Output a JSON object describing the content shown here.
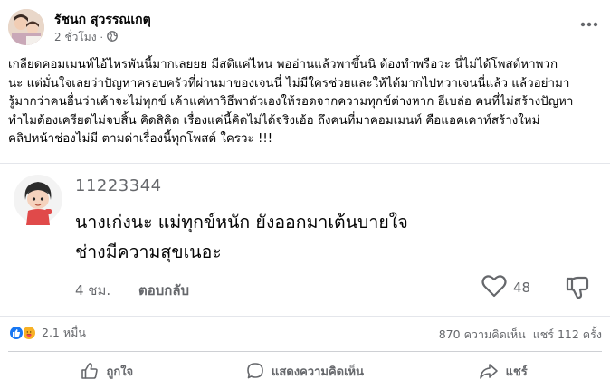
{
  "post": {
    "author": "รัชนก สุวรรณเกตุ",
    "time": "2 ชั่วโมง",
    "dot": "·",
    "audience_icon": "globe-icon",
    "more_icon": "more-horizontal-icon",
    "text_lines": [
      "เกลียดคอมเมนท์ไอ้ไหรพันนี้มากเลยยย มีสติแค่ไหน พออ่านแล้วพาขึ้นนิ ต้องทำพรือวะ นี่ไม่ได้โพสต์หาพวก",
      "นะ แต่มั่นใจเลยว่าปัญหาครอบครัวที่ผ่านมาของเจนนี่ ไม่มีใครช่วยและให้ได้มากไปหวาเจนนี่แล้ว แล้วอย่ามา",
      "รู้มากว่าคนอื่นว่าเค้าจะไม่ทุกข์ เค้าแค่หาวิธีพาตัวเองให้รอดจากความทุกข์ต่างหาก อีเบล่อ คนที่ไม่สร้างปัญหา",
      "ทำไมต้องเครียดไม่จบสิ้น คิดสิคิด เรื่องแค่นี้คิดไม่ได้จริงเอ้อ ถึงคนที่มาคอมเมนท์ คือแอคเคาท์สร้างใหม่",
      "คลิปหน้าช่องไม่มี ตามด่าเรื่องนี้ทุกโพสต์ ใครวะ !!!"
    ]
  },
  "comment": {
    "username": "11223344",
    "text_lines": [
      "นางเก่งนะ แม่ทุกข์หนัก ยังออกมาเต้นบายใจ",
      "ช่างมีความสุขเนอะ"
    ],
    "time": "4 ชม.",
    "reply_label": "ตอบกลับ",
    "like_count": "48",
    "like_icon": "heart-outline-icon",
    "dislike_icon": "thumbs-down-icon"
  },
  "stats": {
    "reaction_count": "2.1 หมื่น",
    "comments": "870 ความคิดเห็น",
    "shares": "แชร์ 112 ครั้ง"
  },
  "actions": {
    "like": "ถูกใจ",
    "comment": "แสดงความคิดเห็น",
    "share": "แชร์"
  },
  "colors": {
    "like_blue": "#1877f2",
    "care_yellow": "#f7b125",
    "secondary_text": "#65676b"
  }
}
